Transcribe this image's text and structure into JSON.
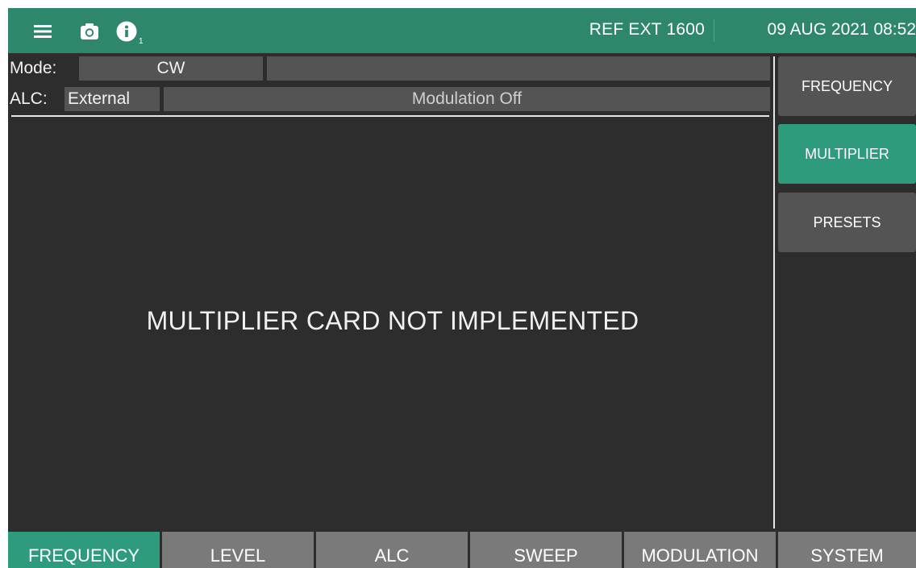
{
  "topbar": {
    "menu_icon": "menu-icon",
    "camera_icon": "camera-icon",
    "info_icon": "info-icon",
    "info_count": "1",
    "ref_status": "REF EXT 1600",
    "datetime": "09 AUG 2021 08:52",
    "background": "#2e866d"
  },
  "status": {
    "mode_label": "Mode:",
    "mode_value": "CW",
    "alc_label": "ALC:",
    "alc_value": "External",
    "modulation": "Modulation Off"
  },
  "main": {
    "message": "MULTIPLIER CARD NOT IMPLEMENTED"
  },
  "side_menu": {
    "items": [
      {
        "label": "FREQUENCY",
        "active": false
      },
      {
        "label": "MULTIPLIER",
        "active": true
      },
      {
        "label": "PRESETS",
        "active": false
      }
    ]
  },
  "tabs": {
    "items": [
      {
        "label": "FREQUENCY",
        "active": true
      },
      {
        "label": "LEVEL",
        "active": false
      },
      {
        "label": "ALC",
        "active": false
      },
      {
        "label": "SWEEP",
        "active": false
      },
      {
        "label": "MODULATION",
        "active": false
      },
      {
        "label": "SYSTEM",
        "active": false
      }
    ]
  },
  "colors": {
    "accent": "#2e9b7c",
    "topbar": "#2e866d",
    "panel": "#2d2d2d",
    "button": "#545454",
    "tab": "#7a7a7a"
  }
}
